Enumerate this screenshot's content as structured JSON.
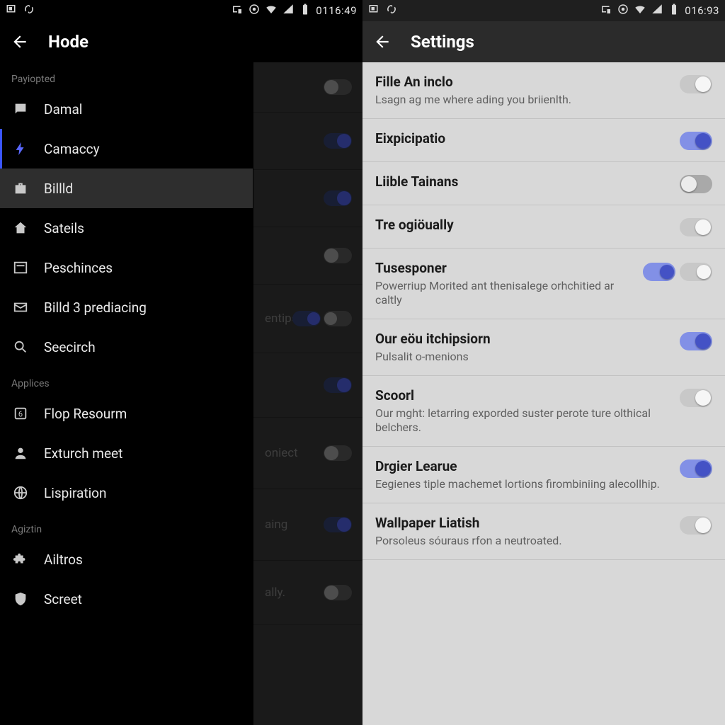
{
  "left": {
    "status": {
      "clock": "0116:49"
    },
    "appbar": {
      "title": "Hode"
    },
    "drawer": {
      "sections": [
        {
          "header": "Payiopted",
          "items": [
            {
              "icon": "chat-icon",
              "label": "Damal"
            },
            {
              "icon": "bolt-icon",
              "label": "Camaccy",
              "accent": true
            },
            {
              "icon": "briefcase-icon",
              "label": "Billld",
              "selected": true
            },
            {
              "icon": "home-icon",
              "label": "Sateils"
            },
            {
              "icon": "panel-icon",
              "label": "Peschinces"
            },
            {
              "icon": "mail-icon",
              "label": "Billd 3 prediacing"
            },
            {
              "icon": "search-icon",
              "label": "Seecirch"
            }
          ]
        },
        {
          "header": "Applices",
          "items": [
            {
              "icon": "box-icon",
              "label": "Flop Resourm"
            },
            {
              "icon": "person-icon",
              "label": "Exturch meet"
            },
            {
              "icon": "globe-icon",
              "label": "Lispiration"
            }
          ]
        },
        {
          "header": "Agiztin",
          "items": [
            {
              "icon": "puzzle-icon",
              "label": "Ailtros"
            },
            {
              "icon": "shield-icon",
              "label": "Screet"
            }
          ]
        }
      ]
    },
    "bg_rows": [
      {
        "label": "",
        "state": "off"
      },
      {
        "label": "",
        "state": "on"
      },
      {
        "label": "",
        "state": "on"
      },
      {
        "label": "",
        "state": "off"
      },
      {
        "label": "entips",
        "state": "dbl"
      },
      {
        "label": "",
        "state": "on"
      },
      {
        "label": "oniect",
        "state": "off"
      },
      {
        "label": "aing",
        "state": "on"
      },
      {
        "label": "ally.",
        "state": "off"
      }
    ]
  },
  "right": {
    "status": {
      "clock": "016:93"
    },
    "appbar": {
      "title": "Settings"
    },
    "rows": [
      {
        "title": "Fille An inclo",
        "sub": "Lsagn ag me where ading you briienlth.",
        "toggle": "offlight"
      },
      {
        "title": "Eixpicipatio",
        "sub": "",
        "toggle": "on"
      },
      {
        "title": "Liible Tainans",
        "sub": "",
        "toggle": "off"
      },
      {
        "title": "Tre ogiöually",
        "sub": "",
        "toggle": "offlight"
      },
      {
        "title": "Tusesponer",
        "sub": "Powerriup Morited ant thenisalege orhchitied ar caltly",
        "toggle": "dbl"
      },
      {
        "title": "Our eöu itchipsiorn",
        "sub": "Pulsalit o-menions",
        "toggle": "on"
      },
      {
        "title": "Scoorl",
        "sub": "Our mght: letarring exporded suster perote ture olthical belchers.",
        "toggle": "offlight"
      },
      {
        "title": "Drgier Learue",
        "sub": "Eegienes tiple machemet lortions firombiniing alecollhip.",
        "toggle": "on"
      },
      {
        "title": "Wallpaper Liatish",
        "sub": "Porsoleus sóuraus rfon a neutroated.",
        "toggle": "offlight"
      }
    ]
  }
}
